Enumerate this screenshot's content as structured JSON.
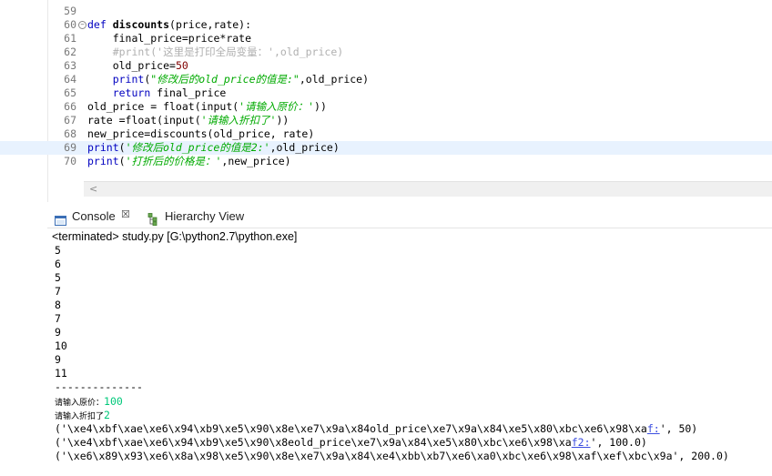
{
  "editor": {
    "lines": [
      {
        "n": "59",
        "tokens": []
      },
      {
        "n": "60",
        "fold": "⊖",
        "tokens": [
          {
            "t": "def ",
            "c": "kw"
          },
          {
            "t": "discounts",
            "c": "fn"
          },
          {
            "t": "(price,rate):",
            "c": ""
          }
        ]
      },
      {
        "n": "61",
        "tokens": [
          {
            "t": "    final_price=price*rate",
            "c": ""
          }
        ]
      },
      {
        "n": "62",
        "tokens": [
          {
            "t": "    #print('这里是打印全局变量：',old_price)",
            "c": "cmt"
          }
        ]
      },
      {
        "n": "63",
        "tokens": [
          {
            "t": "    old_price=",
            "c": ""
          },
          {
            "t": "50",
            "c": "num"
          }
        ]
      },
      {
        "n": "64",
        "tokens": [
          {
            "t": "    ",
            "c": ""
          },
          {
            "t": "print",
            "c": "kw"
          },
          {
            "t": "(",
            "c": ""
          },
          {
            "t": "\"修改后的old_price的值是:\"",
            "c": "str"
          },
          {
            "t": ",old_price)",
            "c": ""
          }
        ]
      },
      {
        "n": "65",
        "tokens": [
          {
            "t": "    ",
            "c": ""
          },
          {
            "t": "return",
            "c": "kw"
          },
          {
            "t": " final_price",
            "c": ""
          }
        ]
      },
      {
        "n": "66",
        "tokens": [
          {
            "t": "old_price = float(input(",
            "c": ""
          },
          {
            "t": "'请输入原价：'",
            "c": "str"
          },
          {
            "t": "))",
            "c": ""
          }
        ]
      },
      {
        "n": "67",
        "tokens": [
          {
            "t": "rate =float(input(",
            "c": ""
          },
          {
            "t": "'请输入折扣了'",
            "c": "str"
          },
          {
            "t": "))",
            "c": ""
          }
        ]
      },
      {
        "n": "68",
        "tokens": [
          {
            "t": "new_price=discounts(old_price, rate)",
            "c": ""
          }
        ]
      },
      {
        "n": "69",
        "highlight": true,
        "tokens": [
          {
            "t": "print",
            "c": "kw"
          },
          {
            "t": "(",
            "c": ""
          },
          {
            "t": "'修改后old_price的值是2:'",
            "c": "str"
          },
          {
            "t": ",old_price)",
            "c": ""
          }
        ]
      },
      {
        "n": "70",
        "tokens": [
          {
            "t": "print",
            "c": "kw"
          },
          {
            "t": "(",
            "c": ""
          },
          {
            "t": "'打折后的价格是：'",
            "c": "str"
          },
          {
            "t": ",new_price)",
            "c": ""
          }
        ]
      }
    ]
  },
  "tabs": {
    "console_label": "Console",
    "console_close": "☒",
    "hierarchy_label": "Hierarchy View"
  },
  "console": {
    "status": "<terminated> study.py [G:\\python2.7\\python.exe]",
    "numbers": [
      "5",
      "6",
      "5",
      "7",
      "8",
      "7",
      "9",
      "10",
      "9",
      "11"
    ],
    "separator": "--------------",
    "prompt_price": "请输入原价：",
    "input_price": "100",
    "prompt_rate": "请输入折扣了",
    "input_rate": "2",
    "result1_pre": "('\\xe4\\xbf\\xae\\xe6\\x94\\xb9\\xe5\\x90\\x8e\\xe7\\x9a\\x84old_price\\xe7\\x9a\\x84\\xe5\\x80\\xbc\\xe6\\x98\\xa",
    "result1_link": "f:",
    "result1_post": "', 50)",
    "result2_pre": "('\\xe4\\xbf\\xae\\xe6\\x94\\xb9\\xe5\\x90\\x8eold_price\\xe7\\x9a\\x84\\xe5\\x80\\xbc\\xe6\\x98\\xa",
    "result2_link": "f2:",
    "result2_post": "', 100.0)",
    "result3": "('\\xe6\\x89\\x93\\xe6\\x8a\\x98\\xe5\\x90\\x8e\\xe7\\x9a\\x84\\xe4\\xbb\\xb7\\xe6\\xa0\\xbc\\xe6\\x98\\xaf\\xef\\xbc\\x9a', 200.0)"
  }
}
